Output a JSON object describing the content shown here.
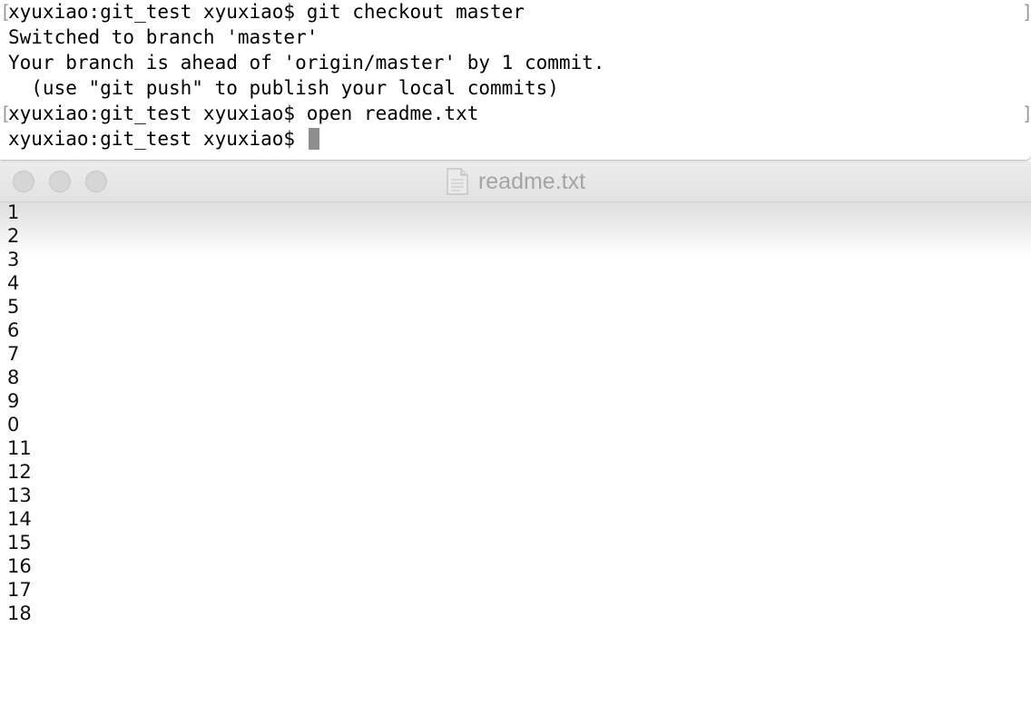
{
  "terminal": {
    "lines": [
      "xyuxiao:git_test xyuxiao$ git checkout master",
      "Switched to branch 'master'",
      "Your branch is ahead of 'origin/master' by 1 commit.",
      "  (use \"git push\" to publish your local commits)",
      "xyuxiao:git_test xyuxiao$ open readme.txt",
      "xyuxiao:git_test xyuxiao$ "
    ],
    "cursor_color": "#8e8e8e"
  },
  "editor": {
    "title": "readme.txt",
    "title_icon": "document-icon",
    "lines": [
      "1",
      "2",
      "3",
      "4",
      "5",
      "6",
      "7",
      "8",
      "9",
      "0",
      "11",
      "12",
      "13",
      "14",
      "15",
      "16",
      "17",
      "18"
    ]
  }
}
